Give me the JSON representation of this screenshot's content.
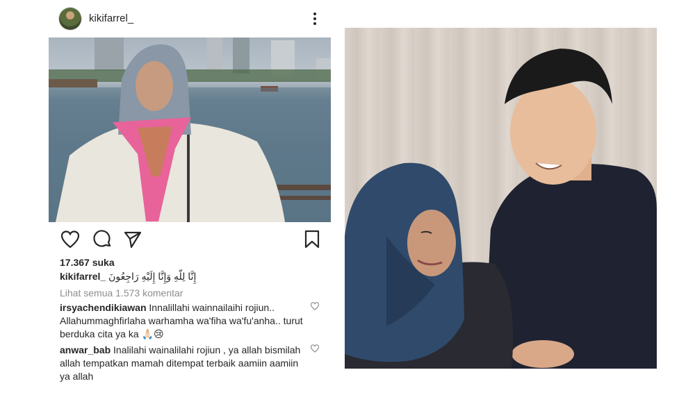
{
  "post": {
    "username": "kikifarrel_",
    "likes": "17.367 suka",
    "caption_user": "kikifarrel_",
    "caption_text": "إِنَّا لِلّهِ وَإِنَّا إِلَيْهِ رَاجِعُونَ",
    "view_all_comments": "Lihat semua 1.573 komentar",
    "comments": [
      {
        "user": "irsyachendikiawan",
        "text": "Innalillahi wainnailaihi rojiun.. Allahummaghfirlaha warhamha wa'fiha wa'fu'anha.. turut berduka cita ya ka 🙏🏻😢"
      },
      {
        "user": "anwar_bab",
        "text": "Inalilahi wainalilahi rojiun , ya allah bismilah allah tempatkan mamah ditempat terbaik aamiin aamiin ya allah"
      }
    ]
  },
  "icons": {
    "more": "more-vertical-icon",
    "like": "heart-icon",
    "comment": "comment-icon",
    "share": "send-icon",
    "save": "bookmark-icon"
  },
  "colors": {
    "text": "#262626",
    "muted": "#8e8e8e",
    "pink_scarf": "#e8639a",
    "navy_hijab": "#2f4a6b"
  }
}
